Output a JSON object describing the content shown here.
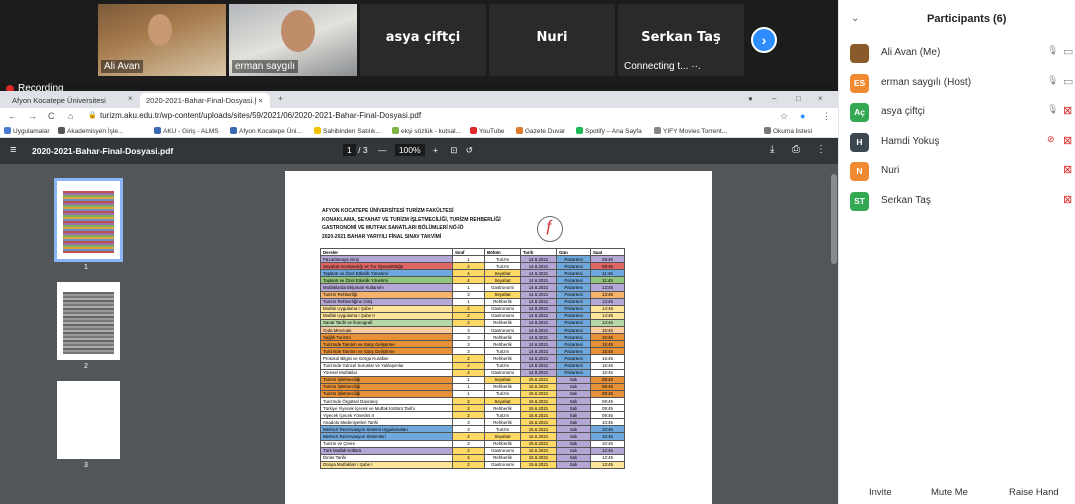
{
  "tiles": [
    {
      "name": "Ali Avan",
      "type": "video"
    },
    {
      "name": "erman saygılı",
      "type": "video"
    },
    {
      "name": "asya çiftçi",
      "type": "name"
    },
    {
      "name": "Nuri",
      "type": "name"
    },
    {
      "name": "Serkan Taş",
      "type": "name",
      "status": "Connecting t... ··."
    }
  ],
  "recording": "Recording",
  "browser": {
    "tabs": [
      "Afyon Kocatepe Üniversitesi",
      "2020-2021-Bahar-Final-Dosyasi.| ×"
    ],
    "url": "turizm.aku.edu.tr/wp-content/uploads/sites/59/2021/06/2020-2021-Bahar-Final-Dosyasi.pdf",
    "bookmarks": [
      "Uygulamalar",
      "Akademisyen İşle...",
      "AKU - Giriş - ALMS",
      "Afyon Kocatepe Üni...",
      "Sahibinden Satılık...",
      "ekşi sözlük - kutsal...",
      "YouTube",
      "Gazete Duvar",
      "Spotify – Ana Sayfa",
      "YIFY Movies Torrent...",
      "Okuma listesi"
    ]
  },
  "pdf": {
    "title": "2020-2021-Bahar-Final-Dosyasi.pdf",
    "page_current": "1",
    "page_total": "/ 3",
    "zoom": "100%",
    "thumbs": [
      "1",
      "2",
      "3"
    ],
    "header_lines": [
      "AFYON KOCATEPE ÜNİVERSİTESİ TURİZM FAKÜLTESİ",
      "KONAKLAMA, SEYAHAT VE TURİZM İŞLETMECİLİĞİ, TURİZM REHBERLİĞİ",
      "GASTRONOMİ VE MUTFAK SANATLARI BÖLÜMLERİ NÖ-İÖ",
      "2020-2021 BAHAR YARIYILI FİNAL SINAV TAKVİMİ"
    ],
    "table_headers": [
      "Dersler",
      "Sınıf",
      "Bölüm",
      "Tarih",
      "Gün",
      "Saat"
    ],
    "rows": [
      [
        "Pazarlamaya Giriş",
        "1",
        "Turizm",
        "14.6.2021",
        "Pazartesi",
        "08:45",
        "#b4a7d6"
      ],
      [
        "Seyahat Acentacılığı ve Tur Operatörlüğü",
        "2",
        "Turizm",
        "14.6.2021",
        "Pazartesi",
        "09:45",
        "#e06666"
      ],
      [
        "Toplantı ve Özel Etkinlik Yönetimi",
        "4",
        "Seyahat",
        "14.6.2021",
        "Pazartesi",
        "11:45",
        "#6fa8dc"
      ],
      [
        "Toplantı ve Özel Etkinlik Yönetimi",
        "4",
        "Seyahat",
        "14.6.2021",
        "Pazartesi",
        "11:45",
        "#93c47d"
      ],
      [
        "Mutfaklarda Ekipman Kullanımı",
        "1",
        "Gastronomi",
        "14.6.2021",
        "Pazartesi",
        "13:45",
        "#b4a7d6"
      ],
      [
        "Turizm Rehberliği",
        "3",
        "Seyahat",
        "14.6.2021",
        "Pazartesi",
        "13:45",
        "#f6b26b"
      ],
      [
        "Turizm Rehberliğine Giriş",
        "1",
        "Rehberlik",
        "14.6.2021",
        "Pazartesi",
        "13:45",
        "#b4a7d6"
      ],
      [
        "Mutfak Uygulama I Şube I",
        "2",
        "Gastronomi",
        "14.6.2021",
        "Pazartesi",
        "14:45",
        "#ffe599"
      ],
      [
        "Mutfak Uygulama I Şube II",
        "2",
        "Gastronomi",
        "14.6.2021",
        "Pazartesi",
        "14:45",
        "#ffe599"
      ],
      [
        "Sanat Tarihi ve İkonografi",
        "2",
        "Rehberlik",
        "14.6.2021",
        "Pazartesi",
        "14:45",
        "#b6d7a8"
      ],
      [
        "Gıda Mevzuatı",
        "3",
        "Gastronomi",
        "14.6.2021",
        "Pazartesi",
        "15:45",
        "#f9cb9c"
      ],
      [
        "Sağlık Turizmi",
        "3",
        "Rehberlik",
        "14.6.2021",
        "Pazartesi",
        "15:45",
        "#e69138"
      ],
      [
        "Turizmde Tanıtım ve Satış Geliştirme",
        "3",
        "Rehberlik",
        "14.6.2021",
        "Pazartesi",
        "15:45",
        "#e69138"
      ],
      [
        "Turizmde Tanıtım ve Satış Geliştirme",
        "3",
        "Turizm",
        "14.6.2021",
        "Pazartesi",
        "15:45",
        "#e69138"
      ],
      [
        "Protokol Bilgisi ve Görgü Kuralları",
        "2",
        "Rehberlik",
        "14.6.2021",
        "Pazartesi",
        "16:45",
        "#ffffff"
      ],
      [
        "Turizmde Güncel Sorunlar ve Yaklaşımlar",
        "4",
        "Turizm",
        "14.6.2021",
        "Pazartesi",
        "16:45",
        "#ffffff"
      ],
      [
        "Yöresel Mutfaklar",
        "4",
        "Gastronomi",
        "14.6.2021",
        "Pazartesi",
        "16:45",
        "#ffffff"
      ],
      [
        "Turizm İşletmeciliği",
        "1",
        "Seyahat",
        "15.6.2021",
        "Salı",
        "08:45",
        "#e69138"
      ],
      [
        "Turizm İşletmeciliği",
        "1",
        "Rehberlik",
        "15.6.2021",
        "Salı",
        "08:45",
        "#e69138"
      ],
      [
        "Turizm İşletmeciliği",
        "1",
        "Turizm",
        "15.6.2021",
        "Salı",
        "08:45",
        "#e69138"
      ],
      [
        "Turizmde Örgütsel Davranış",
        "2",
        "Seyahat",
        "15.6.2021",
        "Salı",
        "09:45",
        "#ffffff"
      ],
      [
        "Türkiye Yiyecek İçecek ve Mutfak Kültürü Tarihi",
        "2",
        "Rehberlik",
        "15.6.2021",
        "Salı",
        "09:45",
        "#ffffff"
      ],
      [
        "Yiyecek İçecek Yönetimi II",
        "2",
        "Turizm",
        "15.6.2021",
        "Salı",
        "09:45",
        "#ffffff"
      ],
      [
        "Anadolu Medeniyetleri Tarihi",
        "3",
        "Rehberlik",
        "15.6.2021",
        "Salı",
        "10:45",
        "#ffffff"
      ],
      [
        "Merkezi Rezervasyon Sistemi Uygulamaları",
        "3",
        "Turizm",
        "15.6.2021",
        "Salı",
        "10:45",
        "#6fa8dc"
      ],
      [
        "Merkezi Rezervasyon Sistemleri",
        "4",
        "Seyahat",
        "15.6.2021",
        "Salı",
        "10:45",
        "#6fa8dc"
      ],
      [
        "Turizm ve Çevre",
        "3",
        "Rehberlik",
        "15.6.2021",
        "Salı",
        "10:45",
        "#ffffff"
      ],
      [
        "Türk Mutfak Kültürü",
        "2",
        "Gastronomi",
        "15.6.2021",
        "Salı",
        "12:45",
        "#b4a7d6"
      ],
      [
        "Dinler Tarihi",
        "4",
        "Rehberlik",
        "15.6.2021",
        "Salı",
        "12:45",
        "#ffffff"
      ],
      [
        "Dünya Mutfakları I Şube I",
        "2",
        "Gastronomi",
        "15.6.2021",
        "Salı",
        "13:45",
        "#ffe599"
      ]
    ],
    "year_colors": {
      "1": "#ffffff",
      "2": "#ffd966",
      "3": "#ffffff",
      "4": "#ffd966"
    },
    "dept_colors": {
      "Seyahat": "#ffd966",
      "Turizm": "#ffffff",
      "Rehberlik": "#ffffff",
      "Gastronomi": "#ffffff"
    },
    "date_colors": {
      "14.6.2021": "#b4a7d6",
      "15.6.2021": "#ffd966"
    },
    "day_colors": {
      "Pazartesi": "#6fa8dc",
      "Salı": "#b4a7d6"
    }
  },
  "panel": {
    "title": "Participants (6)",
    "participants": [
      {
        "name": "Ali Avan (Me)",
        "initials": "",
        "color": "#8b5a2b",
        "mic": "on",
        "cam": "on"
      },
      {
        "name": "erman saygılı (Host)",
        "initials": "ES",
        "color": "#f08a30",
        "mic": "on",
        "cam": "on"
      },
      {
        "name": "asya çiftçi",
        "initials": "Aç",
        "color": "#35a853",
        "mic": "on",
        "cam": "off"
      },
      {
        "name": "Hamdi Yokuş",
        "initials": "H",
        "color": "#3b4650",
        "mic": "off",
        "cam": "off"
      },
      {
        "name": "Nuri",
        "initials": "N",
        "color": "#f08a30",
        "mic": "",
        "cam": "off"
      },
      {
        "name": "Serkan Taş",
        "initials": "ST",
        "color": "#35a853",
        "mic": "",
        "cam": "off"
      }
    ],
    "footer": [
      "Invite",
      "Mute Me",
      "Raise Hand"
    ]
  }
}
